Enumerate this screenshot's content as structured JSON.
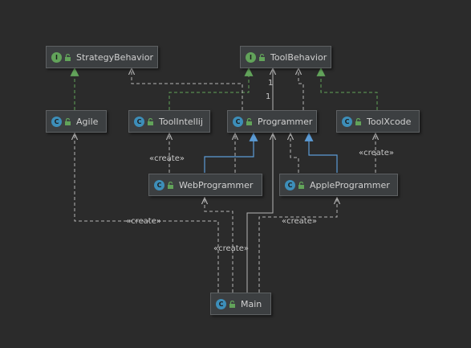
{
  "nodes": {
    "strategy_behavior": {
      "kind": "I",
      "name": "StrategyBehavior"
    },
    "tool_behavior": {
      "kind": "I",
      "name": "ToolBehavior"
    },
    "agile": {
      "kind": "C",
      "name": "Agile"
    },
    "tool_intellij": {
      "kind": "C",
      "name": "ToolIntellij"
    },
    "programmer": {
      "kind": "C",
      "name": "Programmer"
    },
    "tool_xcode": {
      "kind": "C",
      "name": "ToolXcode"
    },
    "web_programmer": {
      "kind": "C",
      "name": "WebProgrammer"
    },
    "apple_programmer": {
      "kind": "C",
      "name": "AppleProgrammer"
    },
    "main": {
      "kind": "C",
      "name": "Main"
    }
  },
  "labels": {
    "create": "«create»",
    "multiplicity_one": "1"
  },
  "colors": {
    "realization": "#62a35a",
    "inheritance": "#5b9bd5",
    "dependency": "#b4b4b4",
    "aggregation": "#b4b4b4",
    "interface_badge": "#62a35a",
    "class_badge": "#3d8eb9"
  }
}
